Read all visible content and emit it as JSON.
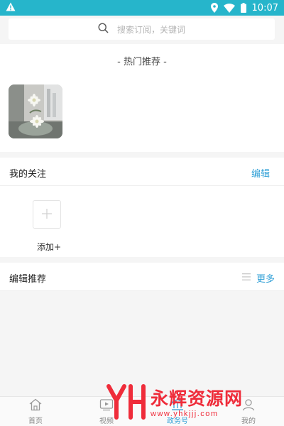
{
  "status_bar": {
    "time": "10:07",
    "icons": [
      "warning-icon",
      "location-icon",
      "wifi-icon",
      "battery-icon"
    ]
  },
  "search": {
    "placeholder": "搜索订阅，关键词",
    "icon": "search-icon"
  },
  "hot": {
    "title": "- 热门推荐 -"
  },
  "my_follow": {
    "title": "我的关注",
    "edit_label": "编辑",
    "add_label": "添加+"
  },
  "editor_recommend": {
    "title": "编辑推荐",
    "more_label": "更多"
  },
  "tabs": [
    {
      "label": "首页",
      "icon": "home-icon",
      "active": false
    },
    {
      "label": "视频",
      "icon": "video-icon",
      "active": false
    },
    {
      "label": "政务号",
      "icon": "government-icon",
      "active": true
    },
    {
      "label": "我的",
      "icon": "user-icon",
      "active": false
    }
  ],
  "watermark": {
    "mark": "YH",
    "name": "永辉资源网",
    "url": "www.yhkjjj.com"
  },
  "colors": {
    "status_bar": "#26b5cb",
    "accent": "#2f9fd6",
    "background": "#f5f5f5",
    "watermark": "#ef2c3a"
  }
}
